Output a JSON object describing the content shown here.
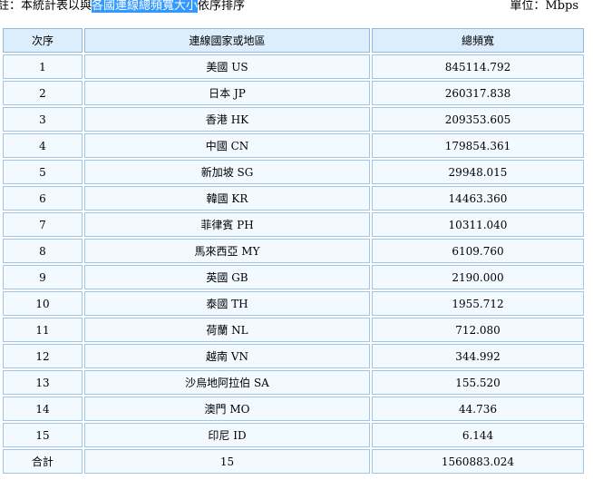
{
  "note": {
    "prefix": "註：本統計表以與",
    "highlight": "各國連線總頻寬大小",
    "suffix": "依序排序"
  },
  "unit_label": "單位：Mbps",
  "table": {
    "headers": [
      "次序",
      "連線國家或地區",
      "總頻寬"
    ],
    "rows": [
      [
        "1",
        "美國 US",
        "845114.792"
      ],
      [
        "2",
        "日本 JP",
        "260317.838"
      ],
      [
        "3",
        "香港 HK",
        "209353.605"
      ],
      [
        "4",
        "中國 CN",
        "179854.361"
      ],
      [
        "5",
        "新加坡 SG",
        "29948.015"
      ],
      [
        "6",
        "韓國 KR",
        "14463.360"
      ],
      [
        "7",
        "菲律賓 PH",
        "10311.040"
      ],
      [
        "8",
        "馬來西亞 MY",
        "6109.760"
      ],
      [
        "9",
        "英國 GB",
        "2190.000"
      ],
      [
        "10",
        "泰國 TH",
        "1955.712"
      ],
      [
        "11",
        "荷蘭 NL",
        "712.080"
      ],
      [
        "12",
        "越南 VN",
        "344.992"
      ],
      [
        "13",
        "沙烏地阿拉伯 SA",
        "155.520"
      ],
      [
        "14",
        "澳門 MO",
        "44.736"
      ],
      [
        "15",
        "印尼 ID",
        "6.144"
      ]
    ],
    "total": [
      "合計",
      "15",
      "1560883.024"
    ]
  }
}
